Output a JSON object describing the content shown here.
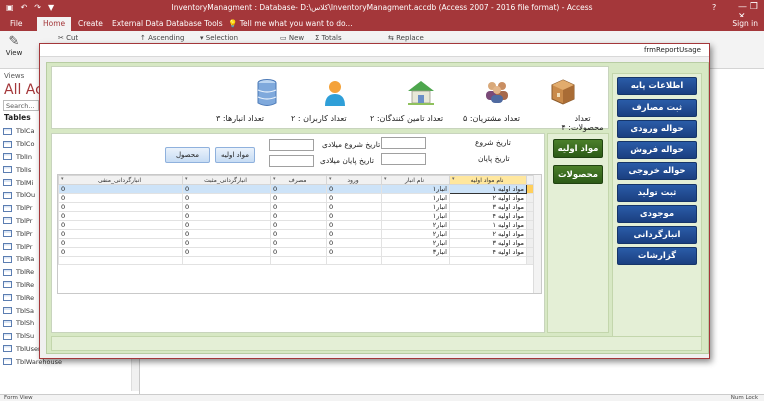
{
  "titlebar": {
    "title": "InventoryManagment : Database- D:\\کلاس\\InventoryManagment.accdb (Access 2007 - 2016 file format) - Access",
    "help": "?",
    "window_controls": "—  ❐  ✕"
  },
  "ribbon_tabs": [
    "File",
    "Home",
    "Create",
    "External Data",
    "Database Tools"
  ],
  "tell_me": "Tell me what you want to do...",
  "sign_in": "Sign in",
  "ribbon_items": [
    "Cut",
    "Ascending",
    "Selection",
    "New",
    "Totals",
    "Replace",
    "View"
  ],
  "nav": {
    "views_label": "Views",
    "header": "All Acc",
    "search": "Search...",
    "tables_label": "Tables",
    "items": [
      "TblCa",
      "TblCo",
      "TblIn",
      "TblIs",
      "TblMi",
      "TblOu",
      "TblPr",
      "TblPr",
      "TblPr",
      "TblPr",
      "TblRa",
      "TblRe",
      "TblRe",
      "TblRe",
      "TblSa",
      "TblSh",
      "TblSu",
      "TblUsers",
      "TblWarehouse"
    ]
  },
  "status": {
    "left": "Form View",
    "right": "Num Lock"
  },
  "form": {
    "title": "frmReportUsage",
    "stats": [
      {
        "label": "تعداد محصولات: ۴",
        "icon": "box-icon"
      },
      {
        "label": "تعداد مشتریان: ۵",
        "icon": "people-icon"
      },
      {
        "label": "تعداد تامین کنندگان: ۲",
        "icon": "house-icon"
      },
      {
        "label": "تعداد کاربران : ۲",
        "icon": "user-icon"
      },
      {
        "label": "تعداد انبارها: ۳",
        "icon": "database-icon"
      }
    ],
    "sidebar_buttons": [
      "اطلاعات پایه",
      "ثبت مصارف",
      "حواله ورودی",
      "حواله فروش",
      "حواله خروجی",
      "ثبت تولید",
      "موجودی",
      "انبارگردانی",
      "گزارشات"
    ],
    "mid_buttons": [
      "مواد اولیه",
      "محصولات"
    ],
    "filters": {
      "start_date": "تاریخ شروع",
      "end_date": "تاریخ پایان",
      "start_gregorian": "تاریخ شروع میلادی",
      "end_gregorian": "تاریخ پایان میلادی"
    },
    "btn_raw": "مواد اولیه",
    "btn_product": "محصول",
    "grid": {
      "columns": [
        "نام مواد اولیه",
        "نام انبار",
        "ورود",
        "مصرف",
        "انبارگردانی_مثبت",
        "انبارگردانی_منفی"
      ],
      "rows": [
        [
          "مواد اولیه ۱",
          "انبار۱",
          "0",
          "0",
          "0",
          "0"
        ],
        [
          "مواد اولیه ۲",
          "انبار۱",
          "0",
          "0",
          "0",
          "0"
        ],
        [
          "مواد اولیه ۳",
          "انبار۱",
          "0",
          "0",
          "0",
          "0"
        ],
        [
          "مواد اولیه ۴",
          "انبار۱",
          "0",
          "0",
          "0",
          "0"
        ],
        [
          "مواد اولیه ۱",
          "انبار۲",
          "0",
          "0",
          "0",
          "0"
        ],
        [
          "مواد اولیه ۲",
          "انبار۲",
          "0",
          "0",
          "0",
          "0"
        ],
        [
          "مواد اولیه ۳",
          "انبار۲",
          "0",
          "0",
          "0",
          "0"
        ],
        [
          "مواد اولیه ۴",
          "انبار۳",
          "0",
          "0",
          "0",
          "0"
        ]
      ]
    }
  }
}
